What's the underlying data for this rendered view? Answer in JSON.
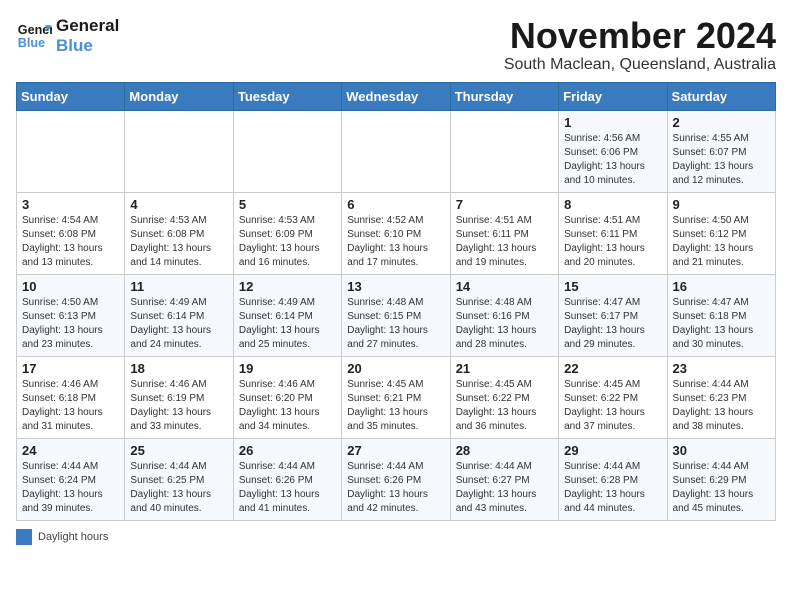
{
  "logo": {
    "text_general": "General",
    "text_blue": "Blue"
  },
  "title": "November 2024",
  "location": "South Maclean, Queensland, Australia",
  "days_of_week": [
    "Sunday",
    "Monday",
    "Tuesday",
    "Wednesday",
    "Thursday",
    "Friday",
    "Saturday"
  ],
  "weeks": [
    {
      "days": [
        {
          "num": "",
          "info": ""
        },
        {
          "num": "",
          "info": ""
        },
        {
          "num": "",
          "info": ""
        },
        {
          "num": "",
          "info": ""
        },
        {
          "num": "",
          "info": ""
        },
        {
          "num": "1",
          "info": "Sunrise: 4:56 AM\nSunset: 6:06 PM\nDaylight: 13 hours\nand 10 minutes."
        },
        {
          "num": "2",
          "info": "Sunrise: 4:55 AM\nSunset: 6:07 PM\nDaylight: 13 hours\nand 12 minutes."
        }
      ]
    },
    {
      "days": [
        {
          "num": "3",
          "info": "Sunrise: 4:54 AM\nSunset: 6:08 PM\nDaylight: 13 hours\nand 13 minutes."
        },
        {
          "num": "4",
          "info": "Sunrise: 4:53 AM\nSunset: 6:08 PM\nDaylight: 13 hours\nand 14 minutes."
        },
        {
          "num": "5",
          "info": "Sunrise: 4:53 AM\nSunset: 6:09 PM\nDaylight: 13 hours\nand 16 minutes."
        },
        {
          "num": "6",
          "info": "Sunrise: 4:52 AM\nSunset: 6:10 PM\nDaylight: 13 hours\nand 17 minutes."
        },
        {
          "num": "7",
          "info": "Sunrise: 4:51 AM\nSunset: 6:11 PM\nDaylight: 13 hours\nand 19 minutes."
        },
        {
          "num": "8",
          "info": "Sunrise: 4:51 AM\nSunset: 6:11 PM\nDaylight: 13 hours\nand 20 minutes."
        },
        {
          "num": "9",
          "info": "Sunrise: 4:50 AM\nSunset: 6:12 PM\nDaylight: 13 hours\nand 21 minutes."
        }
      ]
    },
    {
      "days": [
        {
          "num": "10",
          "info": "Sunrise: 4:50 AM\nSunset: 6:13 PM\nDaylight: 13 hours\nand 23 minutes."
        },
        {
          "num": "11",
          "info": "Sunrise: 4:49 AM\nSunset: 6:14 PM\nDaylight: 13 hours\nand 24 minutes."
        },
        {
          "num": "12",
          "info": "Sunrise: 4:49 AM\nSunset: 6:14 PM\nDaylight: 13 hours\nand 25 minutes."
        },
        {
          "num": "13",
          "info": "Sunrise: 4:48 AM\nSunset: 6:15 PM\nDaylight: 13 hours\nand 27 minutes."
        },
        {
          "num": "14",
          "info": "Sunrise: 4:48 AM\nSunset: 6:16 PM\nDaylight: 13 hours\nand 28 minutes."
        },
        {
          "num": "15",
          "info": "Sunrise: 4:47 AM\nSunset: 6:17 PM\nDaylight: 13 hours\nand 29 minutes."
        },
        {
          "num": "16",
          "info": "Sunrise: 4:47 AM\nSunset: 6:18 PM\nDaylight: 13 hours\nand 30 minutes."
        }
      ]
    },
    {
      "days": [
        {
          "num": "17",
          "info": "Sunrise: 4:46 AM\nSunset: 6:18 PM\nDaylight: 13 hours\nand 31 minutes."
        },
        {
          "num": "18",
          "info": "Sunrise: 4:46 AM\nSunset: 6:19 PM\nDaylight: 13 hours\nand 33 minutes."
        },
        {
          "num": "19",
          "info": "Sunrise: 4:46 AM\nSunset: 6:20 PM\nDaylight: 13 hours\nand 34 minutes."
        },
        {
          "num": "20",
          "info": "Sunrise: 4:45 AM\nSunset: 6:21 PM\nDaylight: 13 hours\nand 35 minutes."
        },
        {
          "num": "21",
          "info": "Sunrise: 4:45 AM\nSunset: 6:22 PM\nDaylight: 13 hours\nand 36 minutes."
        },
        {
          "num": "22",
          "info": "Sunrise: 4:45 AM\nSunset: 6:22 PM\nDaylight: 13 hours\nand 37 minutes."
        },
        {
          "num": "23",
          "info": "Sunrise: 4:44 AM\nSunset: 6:23 PM\nDaylight: 13 hours\nand 38 minutes."
        }
      ]
    },
    {
      "days": [
        {
          "num": "24",
          "info": "Sunrise: 4:44 AM\nSunset: 6:24 PM\nDaylight: 13 hours\nand 39 minutes."
        },
        {
          "num": "25",
          "info": "Sunrise: 4:44 AM\nSunset: 6:25 PM\nDaylight: 13 hours\nand 40 minutes."
        },
        {
          "num": "26",
          "info": "Sunrise: 4:44 AM\nSunset: 6:26 PM\nDaylight: 13 hours\nand 41 minutes."
        },
        {
          "num": "27",
          "info": "Sunrise: 4:44 AM\nSunset: 6:26 PM\nDaylight: 13 hours\nand 42 minutes."
        },
        {
          "num": "28",
          "info": "Sunrise: 4:44 AM\nSunset: 6:27 PM\nDaylight: 13 hours\nand 43 minutes."
        },
        {
          "num": "29",
          "info": "Sunrise: 4:44 AM\nSunset: 6:28 PM\nDaylight: 13 hours\nand 44 minutes."
        },
        {
          "num": "30",
          "info": "Sunrise: 4:44 AM\nSunset: 6:29 PM\nDaylight: 13 hours\nand 45 minutes."
        }
      ]
    }
  ],
  "legend": {
    "color_label": "Daylight hours"
  }
}
